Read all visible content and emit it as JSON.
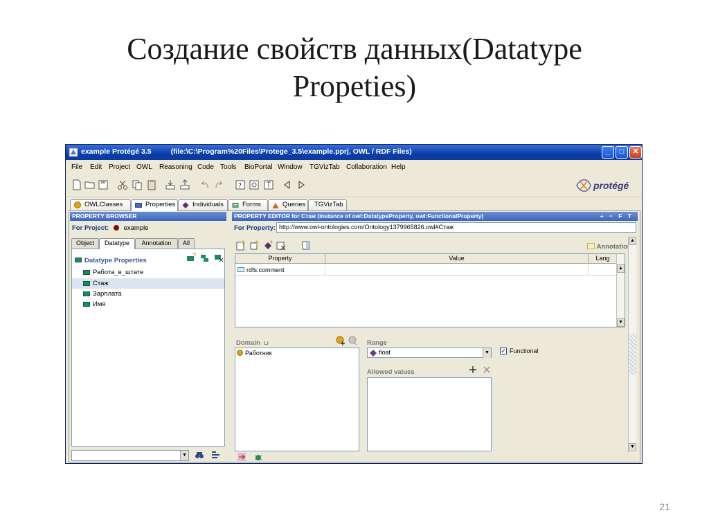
{
  "slide": {
    "title_line1": "Создание свойств данных(Datatype",
    "title_line2": "Propeties)",
    "page_number": "21"
  },
  "window": {
    "app_title": "example  Protégé 3.5",
    "file_info": "(file:\\C:\\Program%20Files\\Protege_3.5\\example.pprj, OWL / RDF Files)",
    "controls": {
      "minimize": "_",
      "maximize": "□",
      "close": "✕"
    }
  },
  "menu": [
    {
      "label": "File"
    },
    {
      "label": "Edit"
    },
    {
      "label": "Project"
    },
    {
      "label": "OWL"
    },
    {
      "label": "Reasoning"
    },
    {
      "label": "Code"
    },
    {
      "label": "Tools"
    },
    {
      "label": "BioPortal"
    },
    {
      "label": "Window"
    },
    {
      "label": "TGVizTab"
    },
    {
      "label": "Collaboration"
    },
    {
      "label": "Help"
    }
  ],
  "logo_text": "protégé",
  "main_tabs": [
    {
      "label": "OWLClasses",
      "icon": "class-circle-icon"
    },
    {
      "label": "Properties",
      "icon": "property-rect-icon"
    },
    {
      "label": "Individuals",
      "icon": "individual-diamond-icon"
    },
    {
      "label": "Forms",
      "icon": "forms-icon"
    },
    {
      "label": "Queries",
      "icon": "queries-icon"
    },
    {
      "label": "TGVizTab",
      "icon": ""
    }
  ],
  "property_browser": {
    "header": "PROPERTY BROWSER",
    "for_project_label": "For Project:",
    "project_name": "example",
    "tabs": [
      {
        "label": "Object"
      },
      {
        "label": "Datatype"
      },
      {
        "label": "Annotation"
      },
      {
        "label": "All"
      }
    ],
    "root": "Datatype Properties",
    "items": [
      {
        "label": "Работа_в_штате",
        "selected": false
      },
      {
        "label": "Стаж",
        "selected": true
      },
      {
        "label": "Зарплата",
        "selected": false
      },
      {
        "label": "Имя",
        "selected": false
      }
    ]
  },
  "property_editor": {
    "header": "PROPERTY EDITOR for Стаж   (instance of owl:DatatypeProperty, owl:FunctionalProperty)",
    "header_controls": "+ − F T",
    "for_property_label": "For Property:",
    "uri": "http://www.owl-ontologies.com/Ontology1379965826.owl#Стаж",
    "annotations_label": "Annotations",
    "columns": [
      "Property",
      "Value",
      "Lang"
    ],
    "rows": [
      {
        "property": "rdfs:comment",
        "value": "",
        "lang": ""
      }
    ],
    "domain_label": "Domain",
    "domain_marker": "LI",
    "domain_items": [
      {
        "label": "Работник"
      }
    ],
    "range_label": "Range",
    "range_value": "float",
    "functional_label": "Functional",
    "functional_checked": true,
    "allowed_values_label": "Allowed values"
  }
}
